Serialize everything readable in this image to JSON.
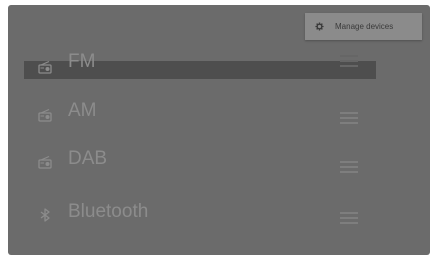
{
  "menu": {
    "items": [
      {
        "label": "Manage devices",
        "icon": "gear-icon"
      }
    ]
  },
  "sources": [
    {
      "label": "FM",
      "icon": "radio-icon",
      "selected": true
    },
    {
      "label": "AM",
      "icon": "radio-icon",
      "selected": false
    },
    {
      "label": "DAB",
      "icon": "radio-icon",
      "selected": false
    },
    {
      "label": "Bluetooth",
      "icon": "bluetooth-icon",
      "selected": false
    }
  ],
  "colors": {
    "background": "#6b6b6b",
    "selected_row": "#4e4e4e",
    "text": "#8c8c8c",
    "menu_background": "#8b8b8b"
  }
}
